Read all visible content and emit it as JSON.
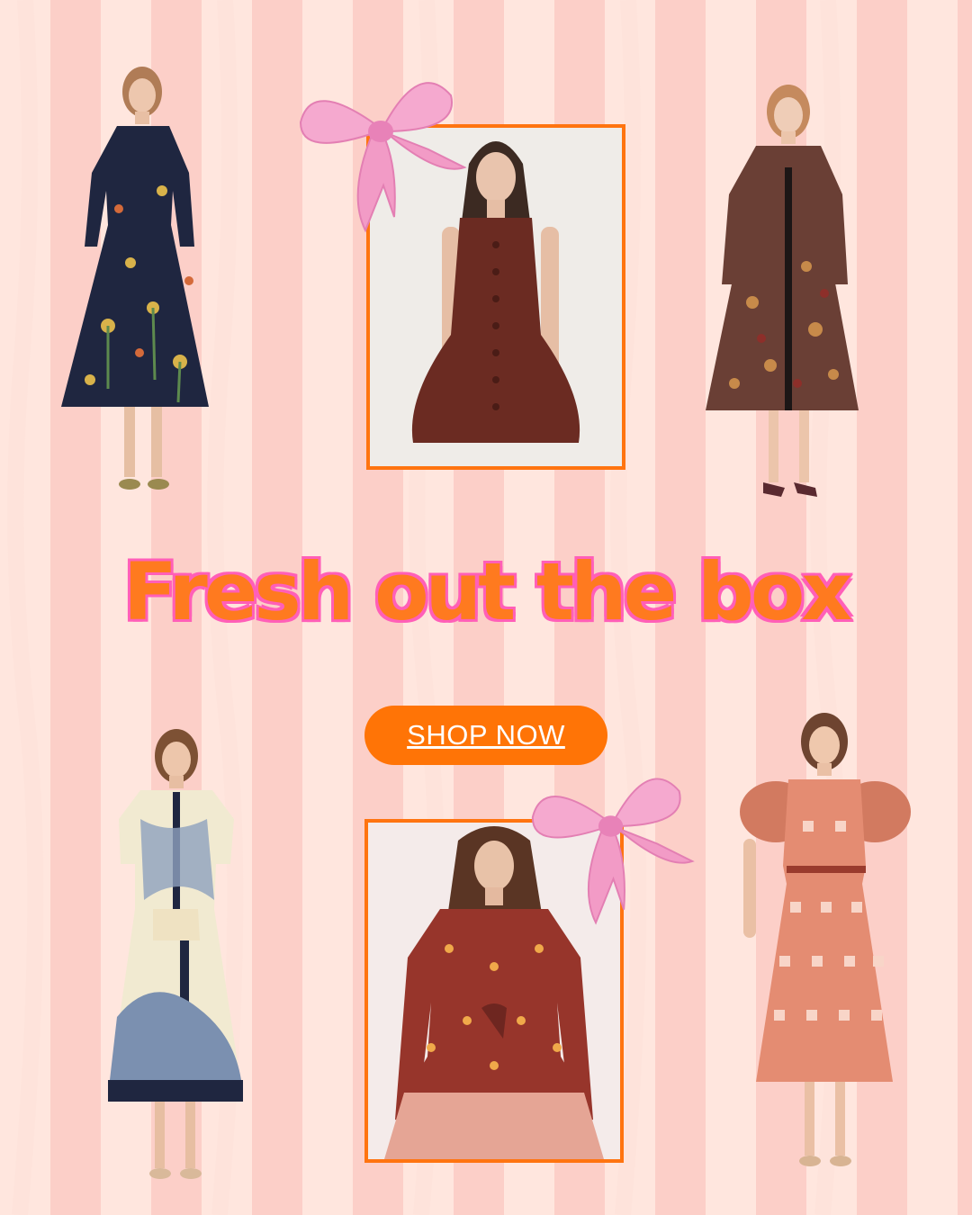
{
  "headline": "Fresh out the box",
  "cta": {
    "label": "SHOP NOW"
  },
  "colors": {
    "accent_orange": "#ff7406",
    "headline_pink_outline": "#ff5fb8",
    "stripe_light": "#ffe6de",
    "stripe_dark": "#fccfc8",
    "bow_pink": "#f79ac9"
  },
  "products": [
    {
      "name": "navy-floral-shirt-dress",
      "style": "cutout"
    },
    {
      "name": "brown-leather-mini-dress",
      "style": "framed"
    },
    {
      "name": "paisley-midi-dress",
      "style": "cutout"
    },
    {
      "name": "cream-blue-scarf-print-dress",
      "style": "cutout"
    },
    {
      "name": "red-geometric-mini-dress",
      "style": "framed"
    },
    {
      "name": "pink-lattice-puff-sleeve-dress",
      "style": "cutout"
    }
  ],
  "icons": [
    "pink-bow-icon",
    "pink-bow-icon"
  ]
}
